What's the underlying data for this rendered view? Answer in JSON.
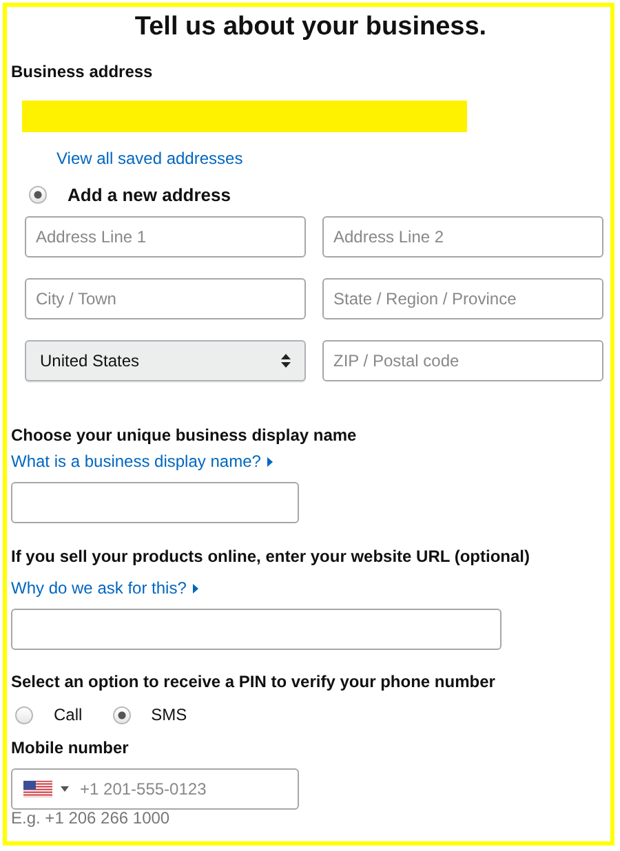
{
  "title": "Tell us about your business.",
  "business_address": {
    "label": "Business address",
    "redacted": true,
    "saved_link": "View all saved addresses",
    "new_address": {
      "label": "Add a new address",
      "selected": true
    },
    "fields": [
      {
        "kind": "input",
        "placeholder": "Address Line 1"
      },
      {
        "kind": "input",
        "placeholder": "Address Line 2"
      },
      {
        "kind": "input",
        "placeholder": "City / Town"
      },
      {
        "kind": "input",
        "placeholder": "State / Region / Province"
      },
      {
        "kind": "select",
        "value": "United States"
      },
      {
        "kind": "input",
        "placeholder": "ZIP / Postal code"
      }
    ]
  },
  "display_name": {
    "label": "Choose your unique business display name",
    "help_link": "What is a business display name?"
  },
  "website": {
    "label": "If you sell your products online, enter your website URL (optional)",
    "help_link": "Why do we ask for this?"
  },
  "pin": {
    "label": "Select an option to receive a PIN to verify your phone number",
    "options": [
      {
        "label": "Call",
        "selected": false
      },
      {
        "label": "SMS",
        "selected": true
      }
    ]
  },
  "mobile": {
    "label": "Mobile number",
    "placeholder": "+1 201-555-0123",
    "hint": "E.g. +1 206 266 1000"
  }
}
